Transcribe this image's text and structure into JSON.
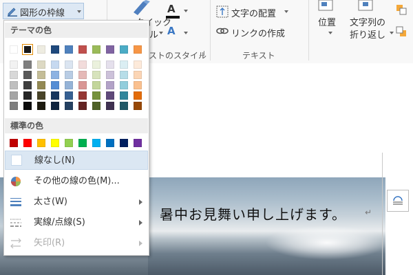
{
  "ribbon": {
    "outline_button": "図形の枠線",
    "quick_styles_line1": "クイック",
    "quick_styles_line2": "ル",
    "text_style_group": "ストのスタイル",
    "text_direction": "文字の配置",
    "create_link": "リンクの作成",
    "text_group": "テキスト",
    "position": "位置",
    "wrap_text_line1": "文字列の",
    "wrap_text_line2": "折り返し"
  },
  "menu": {
    "theme_colors_title": "テーマの色",
    "theme_top_row": [
      "#ffffff",
      "#1a1a1a",
      "#eeece1",
      "#1f497d",
      "#4f81bd",
      "#c0504d",
      "#9bbb59",
      "#8064a2",
      "#4bacc6",
      "#f79646"
    ],
    "theme_selected_index": 1,
    "theme_shades": [
      [
        "#f2f2f2",
        "#d8d8d8",
        "#bfbfbf",
        "#a5a5a5",
        "#7f7f7f"
      ],
      [
        "#7f7f7f",
        "#595959",
        "#3f3f3f",
        "#262626",
        "#0c0c0c"
      ],
      [
        "#ddd9c3",
        "#c4bd97",
        "#938953",
        "#494429",
        "#1d1b10"
      ],
      [
        "#c6d9f0",
        "#8db3e2",
        "#548dd4",
        "#17365d",
        "#0f243e"
      ],
      [
        "#dbe5f1",
        "#b8cce4",
        "#95b3d7",
        "#366092",
        "#244061"
      ],
      [
        "#f2dcdb",
        "#e5b9b7",
        "#d99694",
        "#953734",
        "#632423"
      ],
      [
        "#ebf1dd",
        "#d7e3bc",
        "#c3d69b",
        "#76923c",
        "#4f6128"
      ],
      [
        "#e5e0ec",
        "#ccc1d9",
        "#b2a2c7",
        "#5f497a",
        "#3f3151"
      ],
      [
        "#dbeef3",
        "#b7dde8",
        "#92cddc",
        "#31859b",
        "#205867"
      ],
      [
        "#fdeada",
        "#fbd5b5",
        "#fac08f",
        "#e36c09",
        "#974806"
      ]
    ],
    "standard_colors_title": "標準の色",
    "standard_colors": [
      "#c00000",
      "#ff0000",
      "#ffc000",
      "#ffff00",
      "#92d050",
      "#00b050",
      "#00b0f0",
      "#0070c0",
      "#002060",
      "#7030a0"
    ],
    "no_outline": "線なし(N)",
    "more_colors": "その他の線の色(M)...",
    "weight": "太さ(W)",
    "dashes": "実線/点線(S)",
    "arrows": "矢印(R)"
  },
  "document": {
    "heading": "暑中お見舞い申し上げます。",
    "paragraph_mark": "↵"
  },
  "colors": {
    "accent_hover": "#dbe7f3",
    "selected_outline": "#e28a00"
  }
}
